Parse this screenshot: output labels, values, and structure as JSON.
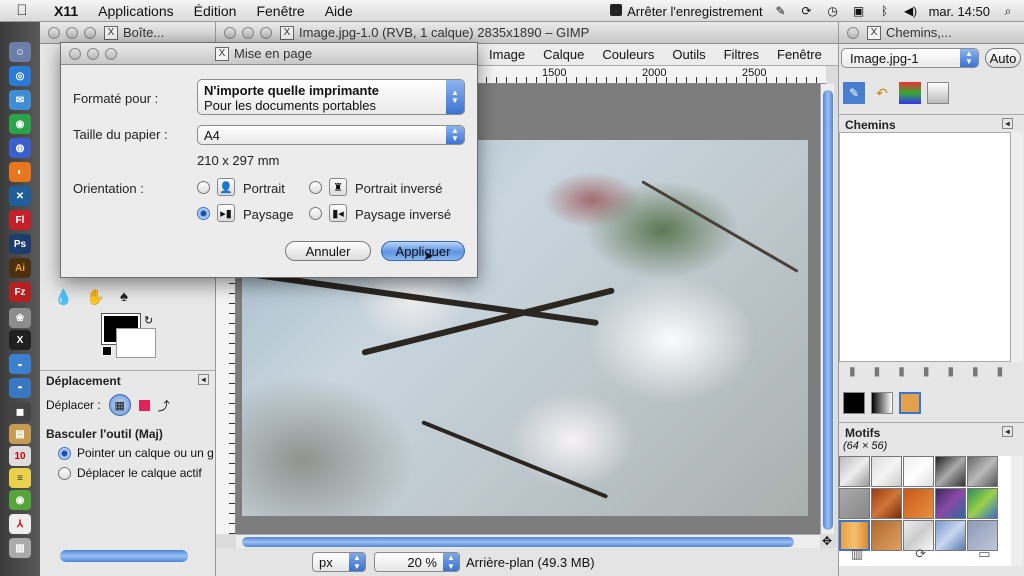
{
  "menubar": {
    "app_name": "X11",
    "items": [
      "Applications",
      "Édition",
      "Fenêtre",
      "Aide"
    ],
    "recording_label": "Arrêter l'enregistrement",
    "clock": "mar. 14:50"
  },
  "toolbox": {
    "title": "Boîte...",
    "move_panel_title": "Déplacement",
    "move_label": "Déplacer :",
    "toggle_tool_label": "Basculer l'outil  (Maj)",
    "option_pick_layer": "Pointer un calque ou un g",
    "option_move_active": "Déplacer le calque actif"
  },
  "image_window": {
    "title": "Image.jpg-1.0 (RVB, 1 calque) 2835x1890 – GIMP",
    "menu": [
      "Image",
      "Calque",
      "Couleurs",
      "Outils",
      "Filtres",
      "Fenêtre"
    ],
    "ruler_marks": [
      "1500",
      "2000",
      "2500"
    ],
    "unit": "px",
    "zoom": "20 %",
    "status": "Arrière-plan (49.3 MB)"
  },
  "right_panel": {
    "title": "Chemins,...",
    "image_selector": "Image.jpg-1",
    "auto_button": "Auto",
    "paths_title": "Chemins",
    "patterns_title": "Motifs",
    "pattern_info": "(64 × 56)"
  },
  "dialog": {
    "title": "Mise en page",
    "format_label": "Formaté pour :",
    "printer_name": "N'importe quelle imprimante",
    "printer_desc": "Pour les documents portables",
    "paper_label": "Taille du papier :",
    "paper_value": "A4",
    "paper_dims": "210 x 297 mm",
    "orientation_label": "Orientation :",
    "portrait": "Portrait",
    "portrait_reversed": "Portrait inversé",
    "landscape": "Paysage",
    "landscape_reversed": "Paysage inversé",
    "cancel": "Annuler",
    "apply": "Appliquer"
  },
  "colors": {
    "accent_blue": "#3b73d1",
    "foreground": "#000000",
    "background": "#ffffff"
  }
}
